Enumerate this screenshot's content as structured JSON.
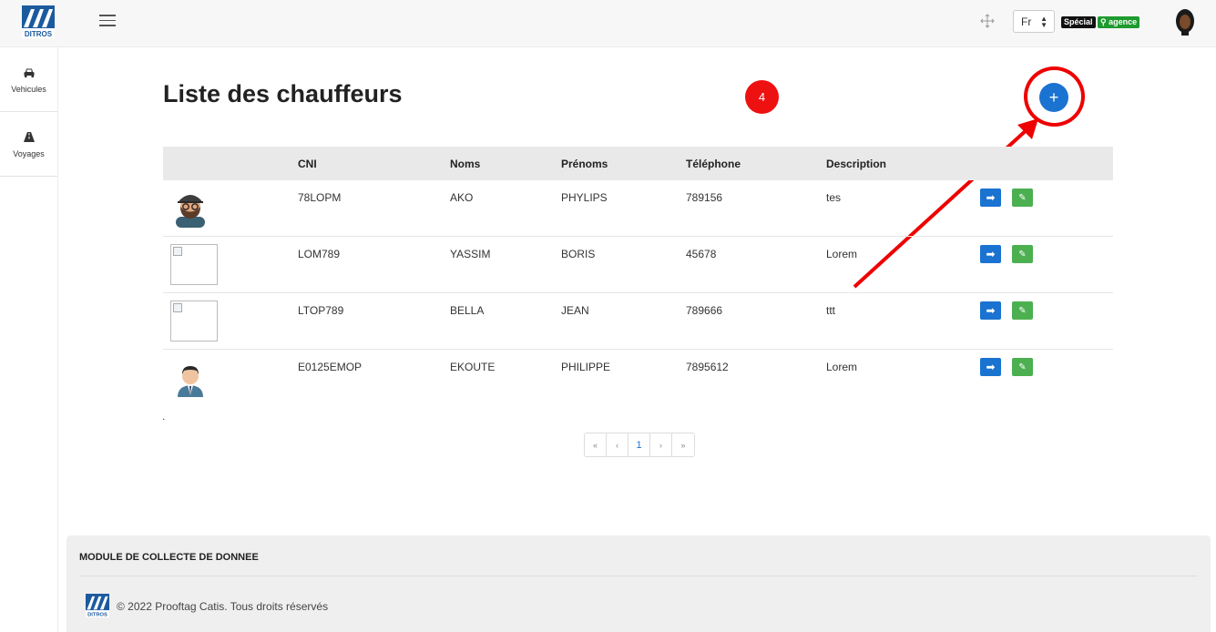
{
  "header": {
    "logo_alt": "DITROS",
    "language": "Fr",
    "badge_special": "Spécial",
    "badge_agence": "agence"
  },
  "sidebar": {
    "items": [
      {
        "label": "Vehicules",
        "icon": "car-icon"
      },
      {
        "label": "Voyages",
        "icon": "road-icon"
      }
    ]
  },
  "main": {
    "title": "Liste des chauffeurs",
    "count": "4",
    "add_label": "+",
    "dot": "."
  },
  "table": {
    "headers": [
      "",
      "CNI",
      "Noms",
      "Prénoms",
      "Téléphone",
      "Description",
      ""
    ],
    "rows": [
      {
        "cni": "78LOPM",
        "nom": "AKO",
        "prenom": "PHYLIPS",
        "tel": "789156",
        "desc": "tes",
        "photo": "avatar-bearded"
      },
      {
        "cni": "LOM789",
        "nom": "YASSIM",
        "prenom": "BORIS",
        "tel": "45678",
        "desc": "Lorem",
        "photo": "broken"
      },
      {
        "cni": "LTOP789",
        "nom": "BELLA",
        "prenom": "JEAN",
        "tel": "789666",
        "desc": "ttt",
        "photo": "broken"
      },
      {
        "cni": "E0125EMOP",
        "nom": "EKOUTE",
        "prenom": "PHILIPPE",
        "tel": "7895612",
        "desc": "Lorem",
        "photo": "avatar-suit"
      }
    ]
  },
  "pagination": {
    "first": "«",
    "prev": "‹",
    "current": "1",
    "next": "›",
    "last": "»"
  },
  "footer": {
    "title": "MODULE DE COLLECTE DE DONNEE",
    "copyright": "© 2022 Prooftag Catis. Tous droits réservés"
  },
  "colors": {
    "primary": "#1a73d1",
    "success": "#4cb050",
    "annotation": "#ee0000"
  }
}
